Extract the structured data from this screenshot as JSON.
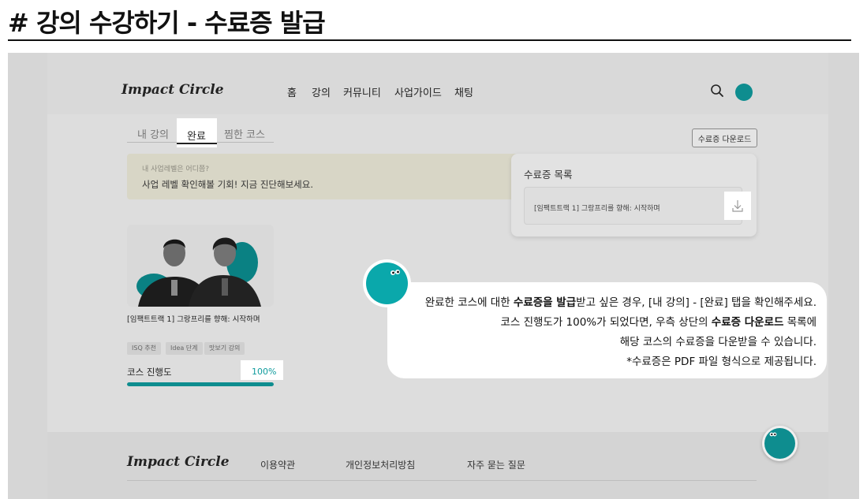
{
  "heading": "# 강의 수강하기 - 수료증 발급",
  "site": {
    "logo": "Impact Circle",
    "nav": [
      "홈",
      "강의",
      "커뮤니티",
      "사업가이드",
      "채팅"
    ],
    "icons": {
      "search": "search-icon",
      "profile": "avatar"
    }
  },
  "tabs": {
    "items": [
      "내 강의",
      "완료",
      "찜한 코스"
    ],
    "active": "완료"
  },
  "cert_download_button": "수료증 다운로드",
  "banner": {
    "question": "내 사업레벨은 어디쯤?",
    "message": "사업 레벨 확인해볼 기회! 지금 진단해보세요."
  },
  "cert_panel": {
    "title": "수료증 목록",
    "items": [
      {
        "name": "[임팩트트랙 1] 그랑프리를 향해: 시작하며",
        "icon": "download-icon"
      }
    ]
  },
  "course": {
    "title": "[임팩트트랙 1] 그랑프리를 향해: 시작하며",
    "tags": [
      "ISQ 추천",
      "Idea 단계",
      "맛보기 강의"
    ],
    "progress_label": "코스 진행도",
    "progress_text": "100%",
    "progress_value": 1.0
  },
  "footer": {
    "logo": "Impact Circle",
    "links": [
      "이용약관",
      "개인정보처리방침",
      "자주 묻는 질문"
    ]
  },
  "callout": {
    "line1_pre": "완료한 코스에 대한 ",
    "line1_bold": "수료증을 발급",
    "line1_post": "받고 싶은 경우, [내 강의] - [완료] 탭을 확인해주세요.",
    "line2_pre": "코스 진행도가 100%가 되었다면, 우측 상단의 ",
    "line2_bold": "수료증 다운로드",
    "line2_post": " 목록에",
    "line3": "해당 코스의 수료증을 다운받을 수 있습니다.",
    "line4": "*수료증은 PDF 파일 형식으로 제공됩니다."
  },
  "colors": {
    "accent": "#0aa8ab",
    "progress": "#0e8d8f",
    "overlay": "#dddddd"
  }
}
